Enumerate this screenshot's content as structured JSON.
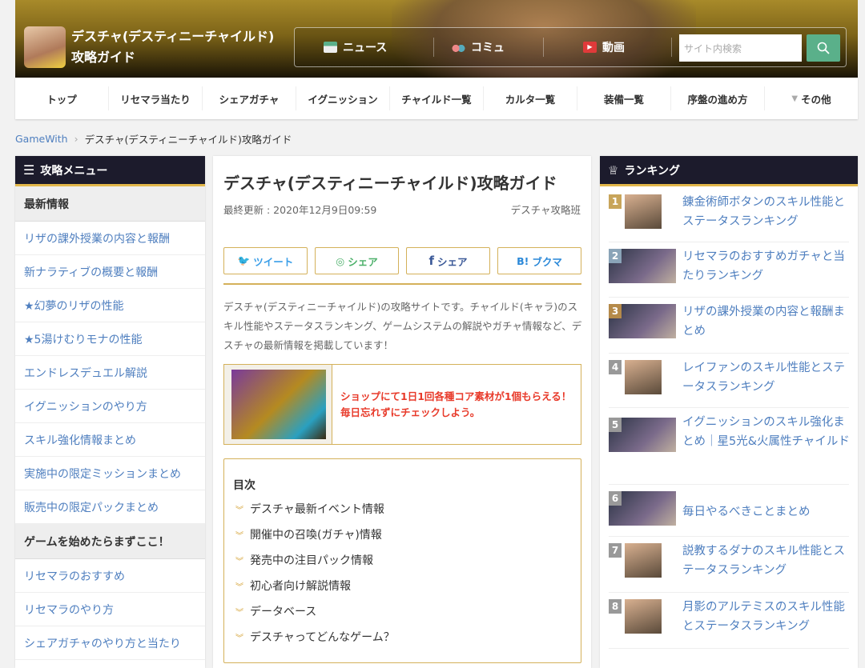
{
  "header": {
    "site_title": "デスチャ(デスティニーチャイルド)攻略ガイド",
    "topnav": [
      {
        "label": "ニュース",
        "icon": "news-icon"
      },
      {
        "label": "コミュ",
        "icon": "community-icon"
      },
      {
        "label": "動画",
        "icon": "video-icon"
      }
    ],
    "search_placeholder": "サイト内検索"
  },
  "nav": [
    "トップ",
    "リセマラ当たり",
    "シェアガチャ",
    "イグニッション",
    "チャイルド一覧",
    "カルタ一覧",
    "装備一覧",
    "序盤の進め方",
    "その他"
  ],
  "breadcrumb": {
    "root": "GameWith",
    "current": "デスチャ(デスティニーチャイルド)攻略ガイド"
  },
  "left": {
    "title": "攻略メニュー",
    "sections": [
      {
        "title": "最新情報",
        "items": [
          "リザの課外授業の内容と報酬",
          "新ナラティブの概要と報酬",
          "★幻夢のリザの性能",
          "★5湯けむりモナの性能",
          "エンドレスデュエル解説",
          "イグニッションのやり方",
          "スキル強化情報まとめ",
          "実施中の限定ミッションまとめ",
          "販売中の限定パックまとめ"
        ]
      },
      {
        "title": "ゲームを始めたらまずここ！",
        "items": [
          "リセマラのおすすめ",
          "リセマラのやり方",
          "シェアガチャのやり方と当たり"
        ]
      }
    ]
  },
  "article": {
    "title": "デスチャ(デスティニーチャイルド)攻略ガイド",
    "updated": "最終更新 : 2020年12月9日09:59",
    "author": "デスチャ攻略班",
    "share": [
      "ツイート",
      "シェア",
      "シェア",
      "ブクマ"
    ],
    "share_prefix": [
      "",
      "",
      "f",
      "B!"
    ],
    "intro": "デスチャ(デスティニーチャイルド)の攻略サイトです。チャイルド(キャラ)のスキル性能やステータスランキング、ゲームシステムの解説やガチャ情報など、デスチャの最新情報を掲載しています！",
    "promo": "ショップにて1日1回各種コア素材が1個もらえる！毎日忘れずにチェックしよう。",
    "toc_title": "目次",
    "toc": [
      "デスチャ最新イベント情報",
      "開催中の召喚(ガチャ)情報",
      "発売中の注目パック情報",
      "初心者向け解説情報",
      "データベース",
      "デスチャってどんなゲーム？"
    ]
  },
  "ranking": {
    "title": "ランキング",
    "items": [
      {
        "rank": "1",
        "title": "錬金術師ボタンのスキル性能とステータスランキング",
        "color": "#c8a55a"
      },
      {
        "rank": "2",
        "title": "リセマラのおすすめガチャと当たりランキング",
        "color": "#8aa4b8"
      },
      {
        "rank": "3",
        "title": "リザの課外授業の内容と報酬まとめ",
        "color": "#b58a4a"
      },
      {
        "rank": "4",
        "title": "レイファンのスキル性能とステータスランキング",
        "color": "#999999"
      },
      {
        "rank": "5",
        "title": "イグニッションのスキル強化まとめ｜星5光&火属性チャイルド",
        "color": "#999999"
      },
      {
        "rank": "6",
        "title": "毎日やるべきことまとめ",
        "color": "#999999"
      },
      {
        "rank": "7",
        "title": "説教するダナのスキル性能とステータスランキング",
        "color": "#999999"
      },
      {
        "rank": "8",
        "title": "月影のアルテミスのスキル性能とステータスランキング",
        "color": "#999999"
      }
    ]
  }
}
